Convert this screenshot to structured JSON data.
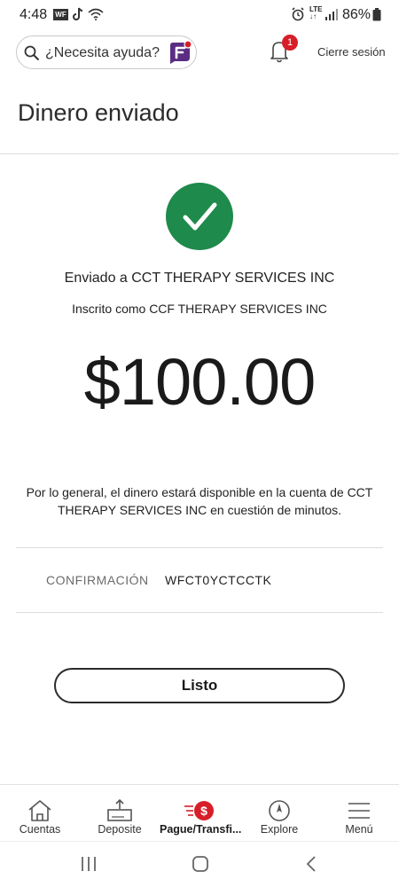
{
  "status_bar": {
    "time": "4:48",
    "wf_badge": "WF",
    "lte_top": "LTE",
    "lte_bottom": "↓↑",
    "battery_pct": "86%"
  },
  "header": {
    "help_text": "¿Necesita ayuda?",
    "notification_count": "1",
    "logout_label": "Cierre sesión"
  },
  "page": {
    "title": "Dinero enviado",
    "sent_to": "Enviado a CCT THERAPY SERVICES INC",
    "enrolled_as": "Inscrito como CCF THERAPY SERVICES INC",
    "amount": "$100.00",
    "availability": "Por lo general, el dinero estará disponible en la cuenta de CCT THERAPY SERVICES INC en cuestión de minutos.",
    "confirmation_label": "CONFIRMACIÓN",
    "confirmation_value": "WFCT0YCTCCTK",
    "done_label": "Listo"
  },
  "bottom_nav": {
    "items": [
      {
        "label": "Cuentas",
        "icon": "home-icon"
      },
      {
        "label": "Deposite",
        "icon": "deposit-icon"
      },
      {
        "label": "Pague/Transfi...",
        "icon": "pay-transfer-icon",
        "active": true
      },
      {
        "label": "Explore",
        "icon": "compass-icon"
      },
      {
        "label": "Menú",
        "icon": "hamburger-menu-icon"
      }
    ]
  },
  "colors": {
    "success_green": "#1e8a4c",
    "brand_red": "#d71e28",
    "assistant_purple": "#5a2d82"
  }
}
